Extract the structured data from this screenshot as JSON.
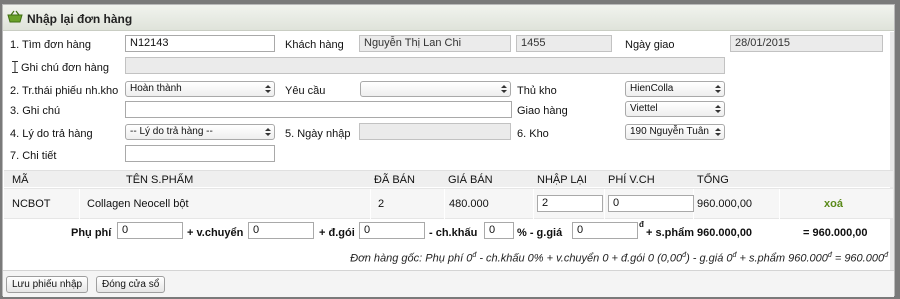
{
  "window": {
    "title": "Nhập lại đơn hàng",
    "title_icon": "basket-icon"
  },
  "form": {
    "find_order_label": "1. Tìm đơn hàng",
    "find_order_value": "N12143",
    "customer_label": "Khách hàng",
    "customer_value": "Nguyễn Thị Lan Chi",
    "customer_id": "1455",
    "delivery_date_label": "Ngày giao",
    "delivery_date_value": "28/01/2015",
    "order_note_label": "Ghi chú đơn hàng",
    "order_note_value": "",
    "slip_status_label": "2. Tr.thái phiếu nh.kho",
    "slip_status_value": "Hoàn thành",
    "request_label": "Yêu cầu",
    "request_value": "",
    "warehouse_keeper_label": "Thủ kho",
    "warehouse_keeper_value": "HienColla",
    "note_label": "3. Ghi chú",
    "note_value": "",
    "shipping_label": "Giao hàng",
    "shipping_value": "Viettel",
    "return_reason_label": "4. Lý do trả hàng",
    "return_reason_value": "-- Lý do trả hàng --",
    "import_date_label": "5. Ngày nhập",
    "import_date_value": "",
    "warehouse_label": "6. Kho",
    "warehouse_value": "190 Nguyễn Tuân",
    "detail_label": "7. Chi tiết",
    "detail_value": ""
  },
  "table": {
    "headers": {
      "code": "MÃ",
      "product": "TÊN S.PHẨM",
      "sold": "ĐÃ BÁN",
      "price": "GIÁ BÁN",
      "reimport": "NHẬP LẠI",
      "ship_fee": "PHÍ V.CH",
      "total": "TỔNG"
    },
    "rows": [
      {
        "code": "NCBOT",
        "product": "Collagen Neocell bột",
        "sold": "2",
        "price": "480.000",
        "reimport": "2",
        "ship_fee": "0",
        "total": "960.000,00",
        "action": "xoá"
      }
    ]
  },
  "surcharge": {
    "label": "Phụ phí",
    "value": "0",
    "shipping_label": "+ v.chuyển",
    "shipping_value": "0",
    "packing_label": "+ đ.gói",
    "packing_value": "0",
    "discount_label": "- ch.khấu",
    "discount_value": "0",
    "discount_unit": "% - g.giá",
    "reduce_value": "0",
    "currency_mark": "đ",
    "product_label": "+ s.phẩm",
    "product_total": "960.000,00",
    "grand_total": "= 960.000,00"
  },
  "original_order": {
    "text1": "Đơn hàng gốc: Phụ phí 0",
    "text2": " - ch.khấu 0% + v.chuyển 0 + đ.gói 0 (0,00",
    "text3": ") - g.giá 0",
    "text4": " + s.phẩm 960.000",
    "text5": " = 960.000",
    "currency_mark": "đ"
  },
  "footer": {
    "save_label": "Lưu phiếu nhập",
    "close_label": "Đóng cửa sổ"
  }
}
